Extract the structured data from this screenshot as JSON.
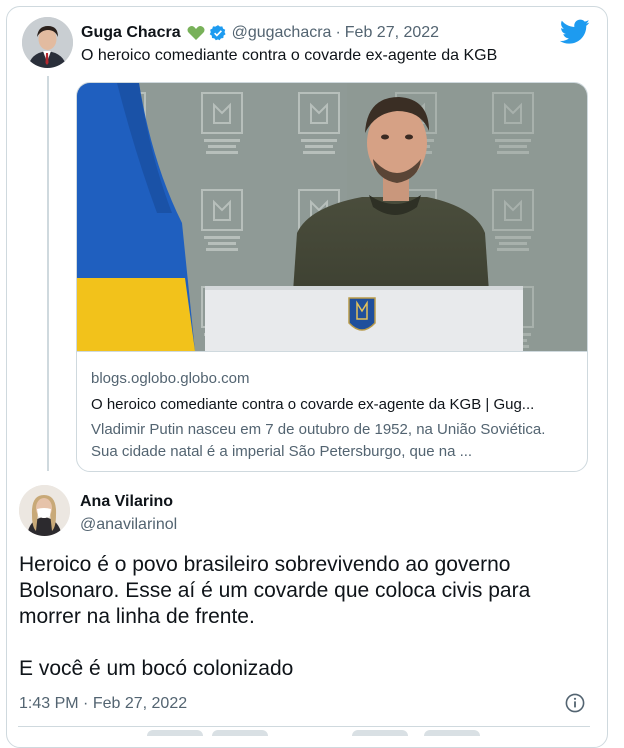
{
  "tweet": {
    "author_name": "Guga Chacra",
    "author_handle": "@gugachacra",
    "separator": "·",
    "date": "Feb 27, 2022",
    "text": "O heroico comediante contra o covarde ex-agente da KGB",
    "icons": [
      "green-heart-icon",
      "verified-badge-icon",
      "twitter-bird-icon"
    ],
    "colors": {
      "accent": "#1d9bf0",
      "heart": "#78b159",
      "muted": "#536471"
    }
  },
  "link_card": {
    "domain": "blogs.oglobo.globo.com",
    "title": "O heroico comediante contra o covarde ex-agente da KGB | Gug...",
    "description": "Vladimir Putin nasceu em 7 de outubro de 1952, na União Soviética. Sua cidade natal é a imperial São Petersburgo, que na ..."
  },
  "reply": {
    "author_name": "Ana Vilarino",
    "author_handle": "@anavilarinol",
    "paragraphs": [
      "Heroico é o povo brasileiro sobrevivendo ao governo Bolsonaro. Esse aí é um covarde que coloca civis para morrer na linha de frente.",
      "E você é um bocó colonizado"
    ],
    "time": "1:43 PM",
    "separator": "·",
    "date": "Feb 27, 2022",
    "icons": [
      "info-icon"
    ]
  }
}
